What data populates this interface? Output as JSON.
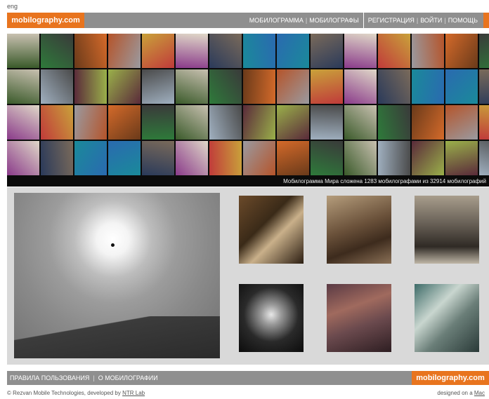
{
  "lang": "eng",
  "header": {
    "logo": "mobilography.com",
    "nav_left": [
      "МОБИЛОГРАММА",
      "МОБИЛОГРАФЫ"
    ],
    "nav_right": [
      "РЕГИСТРАЦИЯ",
      "ВОЙТИ",
      "ПОМОЩЬ"
    ],
    "accent": "#e8741e",
    "bar_color": "#8f8f8f"
  },
  "mosaic": {
    "caption": "Мобилограмма Мира сложена 1283 мобилографами из 32914 мобилографий"
  },
  "footer": {
    "nav": [
      "ПРАВИЛА ПОЛЬЗОВАНИЯ",
      "О МОБИЛОГРАФИИ"
    ],
    "logo": "mobilography.com",
    "copyright_prefix": "© Rezvan Mobile Technologies, developed by",
    "copyright_link": "NTR Lab",
    "designed_prefix": "designed on a",
    "designed_link": "Mac"
  }
}
